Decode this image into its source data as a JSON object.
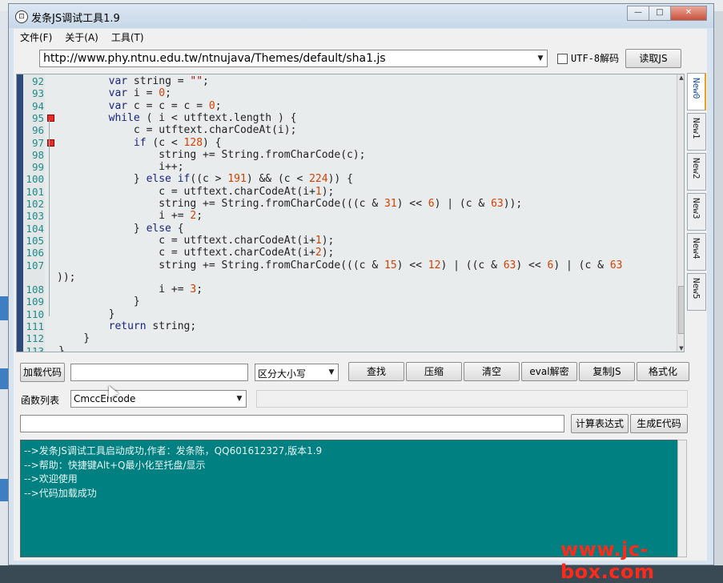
{
  "window": {
    "title": "发条JS调试工具1.9",
    "icon_label": "⊡",
    "minimize": "—",
    "maximize": "□",
    "close": "✕"
  },
  "menubar": {
    "items": [
      "文件(F)",
      "关于(A)",
      "工具(T)"
    ]
  },
  "toolbar": {
    "url": "http://www.phy.ntnu.edu.tw/ntnujava/Themes/default/sha1.js",
    "utf8_label": "UTF-8解码",
    "utf8_checked": false,
    "read_js_label": "读取JS"
  },
  "editor": {
    "lines": [
      {
        "n": "92",
        "code": "        var string = \"\";"
      },
      {
        "n": "93",
        "code": "        var i = 0;"
      },
      {
        "n": "94",
        "code": "        var c = c1 = c2 = 0;"
      },
      {
        "n": "95",
        "code": "        while ( i < utftext.length ) {"
      },
      {
        "n": "96",
        "code": "            c = utftext.charCodeAt(i);"
      },
      {
        "n": "97",
        "code": "            if (c < 128) {"
      },
      {
        "n": "98",
        "code": "                string += String.fromCharCode(c);"
      },
      {
        "n": "99",
        "code": "                i++;"
      },
      {
        "n": "100",
        "code": "            } else if((c > 191) && (c < 224)) {"
      },
      {
        "n": "101",
        "code": "                c2 = utftext.charCodeAt(i+1);"
      },
      {
        "n": "102",
        "code": "                string += String.fromCharCode(((c & 31) << 6) | (c2 & 63));"
      },
      {
        "n": "103",
        "code": "                i += 2;"
      },
      {
        "n": "104",
        "code": "            } else {"
      },
      {
        "n": "105",
        "code": "                c2 = utftext.charCodeAt(i+1);"
      },
      {
        "n": "106",
        "code": "                c3 = utftext.charCodeAt(i+2);"
      },
      {
        "n": "107",
        "code": "                string += String.fromCharCode(((c & 15) << 12) | ((c2 & 63) << 6) | (c3 & 63"
      },
      {
        "n": "",
        "code": "));"
      },
      {
        "n": "108",
        "code": "                i += 3;"
      },
      {
        "n": "109",
        "code": "            }"
      },
      {
        "n": "110",
        "code": "        }"
      },
      {
        "n": "111",
        "code": "        return string;"
      },
      {
        "n": "112",
        "code": "    }"
      },
      {
        "n": "113",
        "code": "}"
      }
    ],
    "breakpoints": [
      "95",
      "97"
    ]
  },
  "tabs": [
    "New0",
    "New1",
    "New2",
    "New3",
    "New4",
    "New5"
  ],
  "active_tab": "New0",
  "search_row": {
    "load_code_label": "加载代码",
    "search_value": "",
    "case_option": "区分大小写",
    "find_label": "查找",
    "compress_label": "压缩",
    "clear_label": "清空",
    "eval_label": "eval解密",
    "copy_label": "复制JS",
    "format_label": "格式化"
  },
  "func_row": {
    "label": "函数列表",
    "selected": "CmccEncode"
  },
  "expr_row": {
    "value": "",
    "calc_label": "计算表达式",
    "gen_label": "生成E代码"
  },
  "log": {
    "lines": [
      "-->发条JS调试工具启动成功,作者：发条陈，QQ601612327,版本1.9",
      "-->帮助：快捷键Alt+Q最小化至托盘/显示",
      "-->欢迎使用",
      "-->代码加载成功"
    ]
  },
  "watermark": "www.jc-box.com",
  "colors": {
    "log_bg": "#008080",
    "accent": "#e8a020",
    "breakpoint": "#e0302a"
  }
}
